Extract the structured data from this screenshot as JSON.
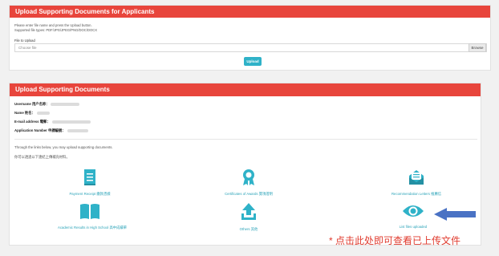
{
  "upload_panel": {
    "title": "Upload Supporting Documents for Applicants",
    "hint_line1": "Please enter file name and press the Upload button.",
    "hint_line2": "Supported file types: PDF/JPG/JPEG/PNG/DOC/DOCX",
    "file_label": "File to Upload",
    "file_placeholder": "Choose file",
    "browse_label": "Browse",
    "upload_label": "Upload"
  },
  "docs_panel": {
    "title": "Upload Supporting Documents",
    "username_label": "Username 用户名称：",
    "name_label": "Name 姓名：",
    "email_label": "E-mail address 電郵：",
    "appno_label": "Application Number 申請編號：",
    "intro_en": "Through the links below, you may upload supporting documents.",
    "intro_zh": "你可以透過以下連結上傳補充材料。",
    "tiles": [
      {
        "label": "Payment Receipt 繳款憑據",
        "icon": "receipt-icon"
      },
      {
        "label": "Certificates of Awards 獎項證明",
        "icon": "award-icon"
      },
      {
        "label": "Recommendation Letters 推薦信",
        "icon": "envelope-icon"
      },
      {
        "label": "Academic Results in High School 高中成績單",
        "icon": "book-icon"
      },
      {
        "label": "Others 其他",
        "icon": "upload-icon"
      },
      {
        "label": "List files uploaded",
        "icon": "eye-icon"
      }
    ]
  },
  "annotation": {
    "note": "* 点击此处即可查看已上传文件",
    "arrow_color": "#4a72c4"
  },
  "colors": {
    "header_red": "#e8453c",
    "accent_teal": "#2fb2c8"
  }
}
